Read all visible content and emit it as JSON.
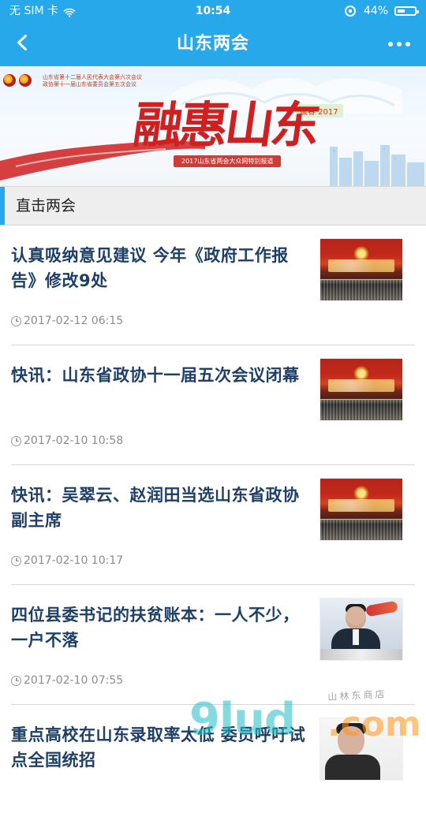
{
  "status_bar": {
    "carrier": "无 SIM 卡",
    "time": "10:54",
    "battery_percent": "44%",
    "battery_level": 0.44
  },
  "nav": {
    "title": "山东两会"
  },
  "banner": {
    "subtitle_line1": "山东省第十二届人民代表大会第六次会议",
    "subtitle_line2": "政协第十一届山东省委员会第五次会议",
    "headline": "融惠山东",
    "tag": "暖春 2017",
    "band_text": "2017山东省两会大众网特别报道"
  },
  "section": {
    "title": "直击两会"
  },
  "news": [
    {
      "title": "认真吸纳意见建议 今年《政府工作报告》修改9处",
      "time": "2017-02-12 06:15"
    },
    {
      "title": "快讯：山东省政协十一届五次会议闭幕",
      "time": "2017-02-10 10:58"
    },
    {
      "title": "快讯：吴翠云、赵润田当选山东省政协副主席",
      "time": "2017-02-10 10:17"
    },
    {
      "title": "四位县委书记的扶贫账本：一人不少，一户不落",
      "time": "2017-02-10 07:55"
    },
    {
      "title": "重点高校在山东录取率太低 委员呼吁试点全国统招",
      "time": ""
    }
  ],
  "watermark": {
    "brand": "9lud",
    "suffix": ".com",
    "shop": "山林东商店"
  },
  "colors": {
    "primary": "#27a8eb",
    "headline_red": "#d01f1f",
    "news_title": "#1e3f66",
    "meta_gray": "#8c8c8c"
  },
  "icons": {
    "back": "back-icon",
    "more": "more-icon",
    "clock": "clock-icon",
    "wifi": "wifi-icon",
    "rotation_lock": "rotation-lock-icon",
    "battery": "battery-icon"
  }
}
